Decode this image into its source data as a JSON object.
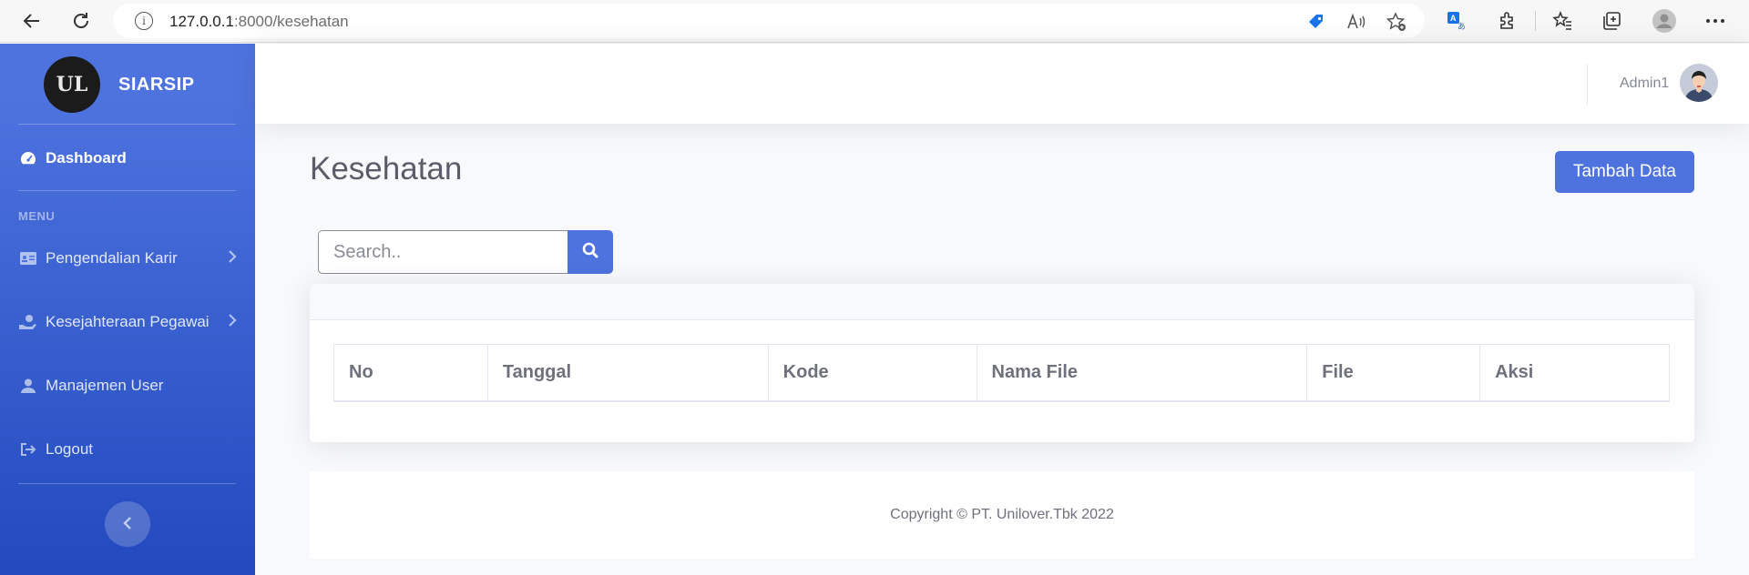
{
  "browser": {
    "url_host": "127.0.0.1",
    "url_path": ":8000/kesehatan"
  },
  "sidebar": {
    "brand_name": "SIARSIP",
    "logo_text": "UL",
    "dashboard_label": "Dashboard",
    "menu_heading": "MENU",
    "items": [
      {
        "label": "Pengendalian Karir",
        "icon": "id-card-icon",
        "has_submenu": true
      },
      {
        "label": "Kesejahteraan Pegawai",
        "icon": "hand-holding-icon",
        "has_submenu": true
      },
      {
        "label": "Manajemen User",
        "icon": "user-icon",
        "has_submenu": false
      },
      {
        "label": "Logout",
        "icon": "sign-out-icon",
        "has_submenu": false
      }
    ]
  },
  "topbar": {
    "user_name": "Admin1"
  },
  "main": {
    "page_title": "Kesehatan",
    "add_button_label": "Tambah Data",
    "search_placeholder": "Search..",
    "table_headers": [
      "No",
      "Tanggal",
      "Kode",
      "Nama File",
      "File",
      "Aksi"
    ]
  },
  "footer": {
    "copyright": "Copyright © PT. Unilover.Tbk 2022"
  },
  "colors": {
    "primary": "#4e73df",
    "sidebar_gradient_end": "#224abe"
  }
}
